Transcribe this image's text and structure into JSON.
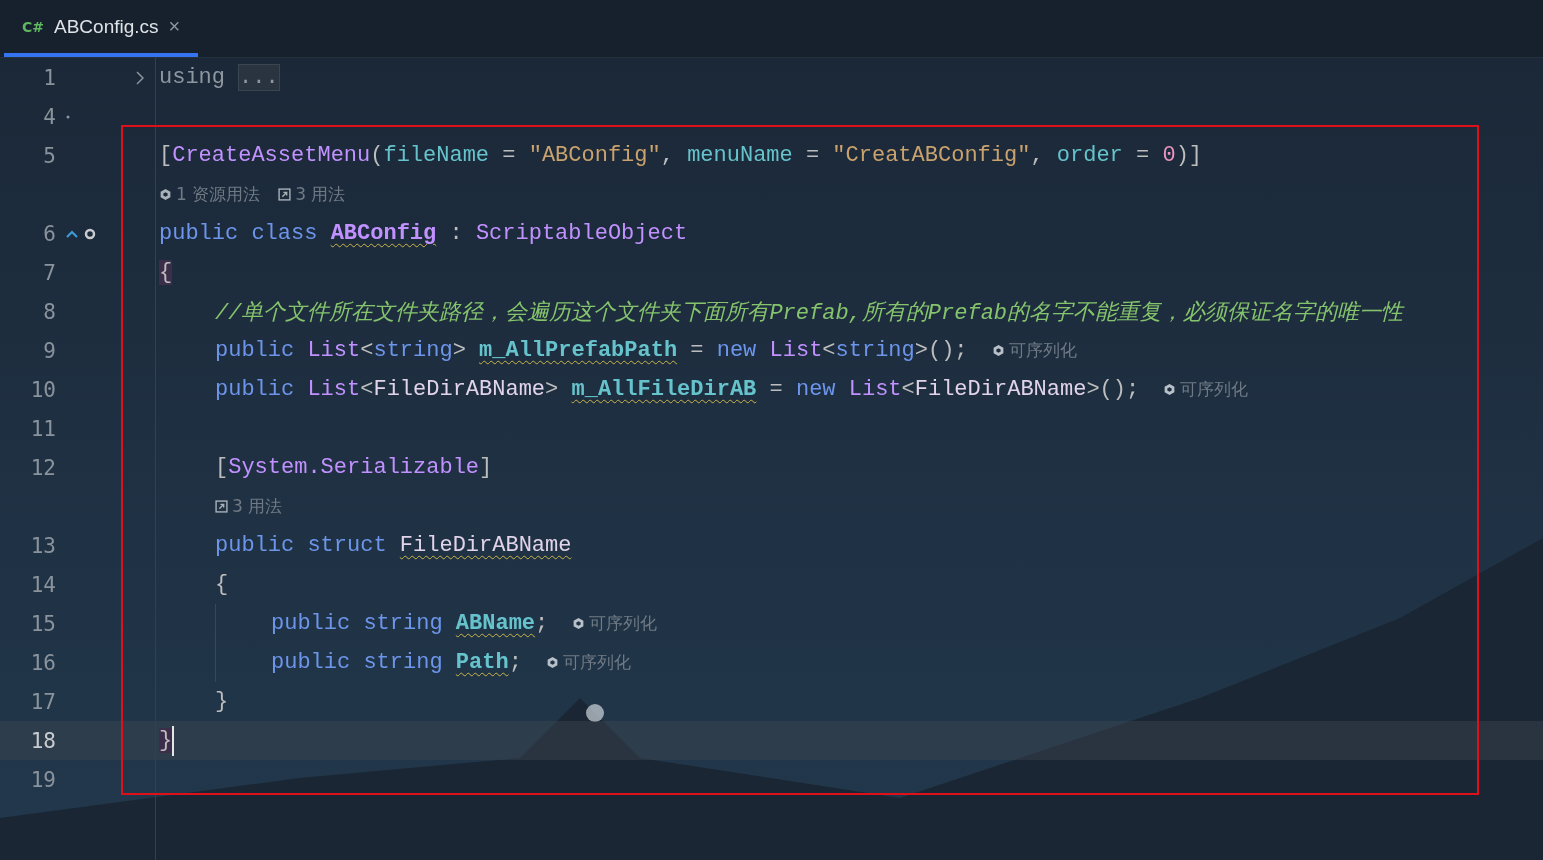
{
  "tab": {
    "language": "C#",
    "title": "ABConfig.cs",
    "close": "×",
    "selected": true
  },
  "rows": [
    {
      "kind": "code",
      "number": "1",
      "folded": true,
      "tokens": [
        {
          "kind": "keyword-dim",
          "text": "using"
        },
        {
          "kind": "fold",
          "text": "..."
        }
      ]
    },
    {
      "kind": "code",
      "number": "4",
      "gutter": [
        {
          "kind": "dot"
        }
      ]
    },
    {
      "kind": "code",
      "number": "5",
      "tokens": [
        {
          "kind": "punct",
          "text": "["
        },
        {
          "kind": "type",
          "text": "CreateAssetMenu"
        },
        {
          "kind": "punct",
          "text": "("
        },
        {
          "kind": "param",
          "text": "fileName"
        },
        {
          "kind": "punct",
          "text": " = "
        },
        {
          "kind": "string",
          "text": "\"ABConfig\""
        },
        {
          "kind": "punct",
          "text": ", "
        },
        {
          "kind": "param",
          "text": "menuName"
        },
        {
          "kind": "punct",
          "text": " = "
        },
        {
          "kind": "string",
          "text": "\"CreatABConfig\""
        },
        {
          "kind": "punct",
          "text": ", "
        },
        {
          "kind": "param",
          "text": "order"
        },
        {
          "kind": "punct",
          "text": " = "
        },
        {
          "kind": "number",
          "text": "0"
        },
        {
          "kind": "punct",
          "text": ")]"
        }
      ]
    },
    {
      "kind": "lens",
      "items": [
        {
          "kind": "unity",
          "text": "1 资源用法"
        },
        {
          "kind": "usages",
          "text": "3 用法"
        }
      ]
    },
    {
      "kind": "code",
      "number": "6",
      "gutter": [
        {
          "kind": "implements"
        },
        {
          "kind": "unity-object"
        }
      ],
      "tokens": [
        {
          "kind": "keyword",
          "text": "public class "
        },
        {
          "kind": "class-name",
          "text": "ABConfig",
          "warn": true
        },
        {
          "kind": "punct",
          "text": " : "
        },
        {
          "kind": "type",
          "text": "ScriptableObject"
        }
      ]
    },
    {
      "kind": "code",
      "number": "7",
      "tokens": [
        {
          "kind": "punct",
          "text": "{",
          "match": true
        }
      ],
      "children": [
        {
          "kind": "code",
          "number": "8",
          "tokens": [
            {
              "kind": "comment",
              "text": "//单个文件所在文件夹路径，会遍历这个文件夹下面所有Prefab,所有的Prefab的名字不能重复，必须保证名字的唯一性"
            }
          ]
        },
        {
          "kind": "code",
          "number": "9",
          "tokens": [
            {
              "kind": "keyword",
              "text": "public "
            },
            {
              "kind": "type",
              "text": "List"
            },
            {
              "kind": "punct",
              "text": "<"
            },
            {
              "kind": "keyword",
              "text": "string"
            },
            {
              "kind": "punct",
              "text": "> "
            },
            {
              "kind": "field",
              "text": "m_AllPrefabPath",
              "warn": true
            },
            {
              "kind": "punct",
              "text": " = "
            },
            {
              "kind": "keyword",
              "text": "new "
            },
            {
              "kind": "type",
              "text": "List"
            },
            {
              "kind": "punct",
              "text": "<"
            },
            {
              "kind": "keyword",
              "text": "string"
            },
            {
              "kind": "punct",
              "text": ">();"
            }
          ],
          "hint": {
            "kind": "unity",
            "text": "可序列化"
          }
        },
        {
          "kind": "code",
          "number": "10",
          "tokens": [
            {
              "kind": "keyword",
              "text": "public "
            },
            {
              "kind": "type",
              "text": "List"
            },
            {
              "kind": "punct",
              "text": "<"
            },
            {
              "kind": "struct",
              "text": "FileDirABName"
            },
            {
              "kind": "punct",
              "text": "> "
            },
            {
              "kind": "field",
              "text": "m_AllFileDirAB",
              "warn": true
            },
            {
              "kind": "punct",
              "text": " = "
            },
            {
              "kind": "keyword",
              "text": "new "
            },
            {
              "kind": "type",
              "text": "List"
            },
            {
              "kind": "punct",
              "text": "<"
            },
            {
              "kind": "struct",
              "text": "FileDirABName"
            },
            {
              "kind": "punct",
              "text": ">();"
            }
          ],
          "hint": {
            "kind": "unity",
            "text": "可序列化"
          }
        },
        {
          "kind": "code",
          "number": "11"
        },
        {
          "kind": "code",
          "number": "12",
          "tokens": [
            {
              "kind": "punct",
              "text": "["
            },
            {
              "kind": "type",
              "text": "System.Serializable"
            },
            {
              "kind": "punct",
              "text": "]"
            }
          ]
        },
        {
          "kind": "lens",
          "items": [
            {
              "kind": "usages",
              "text": "3 用法"
            }
          ]
        },
        {
          "kind": "code",
          "number": "13",
          "tokens": [
            {
              "kind": "keyword",
              "text": "public struct "
            },
            {
              "kind": "struct",
              "text": "FileDirABName",
              "warn": true
            }
          ]
        },
        {
          "kind": "code",
          "number": "14",
          "tokens": [
            {
              "kind": "punct",
              "text": "{"
            }
          ],
          "children": [
            {
              "kind": "code",
              "number": "15",
              "tokens": [
                {
                  "kind": "keyword",
                  "text": "public string "
                },
                {
                  "kind": "field",
                  "text": "ABName",
                  "warn": true
                },
                {
                  "kind": "punct",
                  "text": ";"
                }
              ],
              "hint": {
                "kind": "unity",
                "text": "可序列化"
              }
            },
            {
              "kind": "code",
              "number": "16",
              "tokens": [
                {
                  "kind": "keyword",
                  "text": "public string "
                },
                {
                  "kind": "field",
                  "text": "Path",
                  "warn": true
                },
                {
                  "kind": "punct",
                  "text": ";"
                }
              ],
              "hint": {
                "kind": "unity",
                "text": "可序列化"
              }
            }
          ]
        },
        {
          "kind": "code",
          "number": "17",
          "tokens": [
            {
              "kind": "punct",
              "text": "}"
            }
          ]
        }
      ]
    },
    {
      "kind": "code",
      "number": "18",
      "current": true,
      "tokens": [
        {
          "kind": "punct",
          "text": "}",
          "match": true
        }
      ]
    },
    {
      "kind": "code",
      "number": "19"
    }
  ]
}
